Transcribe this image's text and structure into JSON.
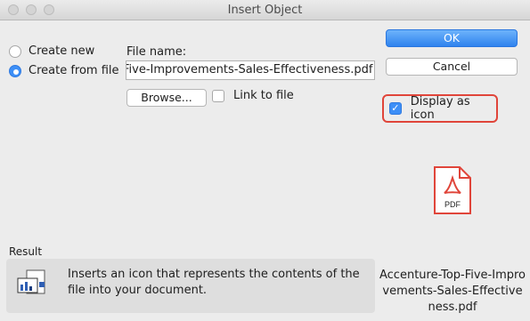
{
  "window": {
    "title": "Insert Object"
  },
  "options": {
    "create_new": "Create new",
    "create_from_file": "Create from file",
    "selected": "create_from_file"
  },
  "file": {
    "label": "File name:",
    "value": "Five-Improvements-Sales-Effectiveness.pdf",
    "browse_label": "Browse...",
    "link_label": "Link to file",
    "link_checked": false
  },
  "buttons": {
    "ok": "OK",
    "cancel": "Cancel"
  },
  "display_as_icon": {
    "label": "Display as icon",
    "checked": true
  },
  "icon_preview": {
    "type_label": "PDF",
    "caption": "Accenture-Top-Five-Improvements-Sales-Effectiveness.pdf"
  },
  "result": {
    "label": "Result",
    "text": "Inserts an icon that represents the contents of the file into your document."
  },
  "colors": {
    "accent": "#3d8ff7",
    "highlight": "#e0453a",
    "pdf_red": "#e0453a"
  }
}
